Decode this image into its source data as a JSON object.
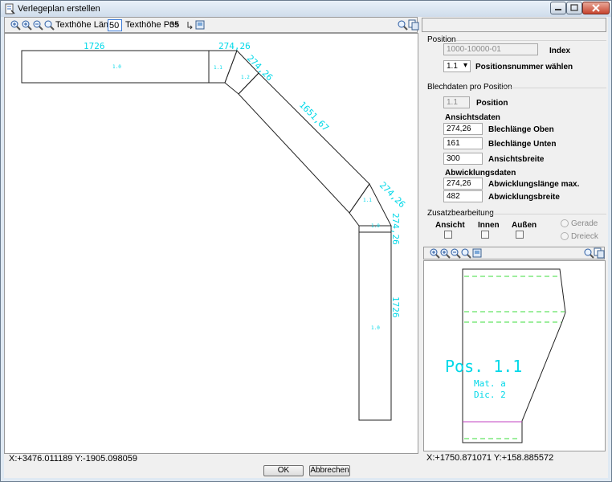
{
  "window": {
    "title": "Verlegeplan erstellen"
  },
  "toolbar": {
    "texthoehe_laenge_label": "Texthöhe Länge",
    "texthoehe_laenge_value": "50",
    "texthoehe_pos_label": "Texthöhe Pos",
    "texthoehe_pos_value": "35"
  },
  "drawing": {
    "dims": {
      "d1": "1726",
      "d2": "274,26",
      "d3": "274,26",
      "d4": "1651,67",
      "d5": "274,26",
      "d6": "274,26",
      "d7": "1726"
    },
    "positions": {
      "p1": "1.0",
      "p2": "1.1",
      "p3": "1.2",
      "p4": "1.1",
      "p5": "1.0",
      "p6": "1.0"
    }
  },
  "status": {
    "main_coords": "X:+3476.011189 Y:-1905.098059",
    "preview_coords": "X:+1750.871071 Y:+158.885572"
  },
  "buttons": {
    "ok": "OK",
    "cancel": "Abbrechen"
  },
  "right": {
    "position_section": "Position",
    "index_value": "1000-10000-01",
    "index_label": "Index",
    "posnr_value": "1.1",
    "posnr_label": "Positionsnummer wählen",
    "blech_section": "Blechdaten pro Position",
    "pos_value": "1.1",
    "pos_label": "Position",
    "ansicht_title": "Ansichtsdaten",
    "blech_oben_value": "274,26",
    "blech_oben_label": "Blechlänge Oben",
    "blech_unten_value": "161",
    "blech_unten_label": "Blechlänge Unten",
    "ansichtsbreite_value": "300",
    "ansichtsbreite_label": "Ansichtsbreite",
    "abw_title": "Abwicklungsdaten",
    "abw_laenge_value": "274,26",
    "abw_laenge_label": "Abwicklungslänge max.",
    "abw_breite_value": "482",
    "abw_breite_label": "Abwicklungsbreite",
    "zusatz_section": "Zusatzbearbeitung",
    "ansicht_label": "Ansicht",
    "innen_label": "Innen",
    "aussen_label": "Außen",
    "gerade_label": "Gerade",
    "dreieck_label": "Dreieck"
  },
  "preview": {
    "pos_text": "Pos. 1.1",
    "mat_text": "Mat. a",
    "dic_text": "Dic. 2"
  },
  "colors": {
    "dim": "#00d8e8",
    "dash_green": "#3ddc3d",
    "dash_purple": "#c040c0"
  }
}
